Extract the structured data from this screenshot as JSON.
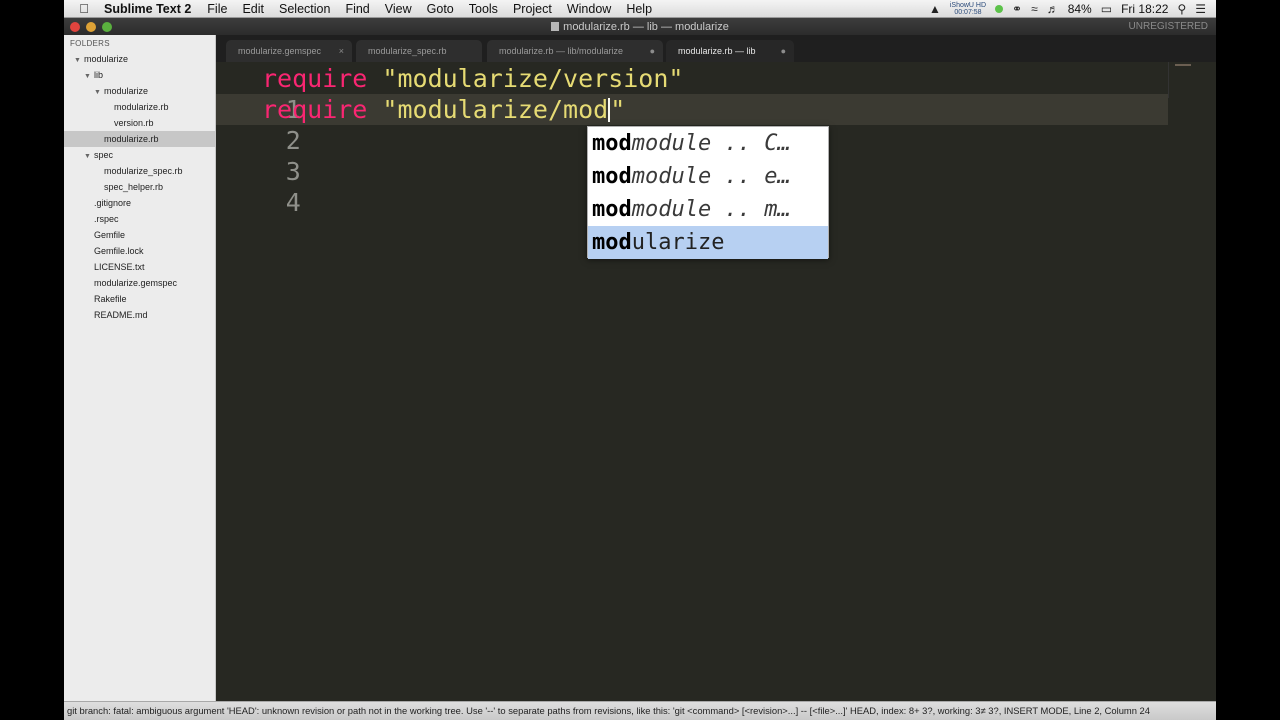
{
  "menubar": {
    "apple_icon": "apple-icon",
    "app_name": "Sublime Text 2",
    "items": [
      "File",
      "Edit",
      "Selection",
      "Find",
      "View",
      "Goto",
      "Tools",
      "Project",
      "Window",
      "Help"
    ],
    "recorder_label": "iShowU HD",
    "recorder_time": "00:07:58",
    "battery": "84%",
    "clock": "Fri 18:22",
    "icons": [
      "drive-icon",
      "headphones-icon",
      "wifi-icon",
      "volume-icon",
      "battery-icon",
      "spotlight-search-icon",
      "notifications-list-icon"
    ]
  },
  "window": {
    "title": "modularize.rb — lib — modularize",
    "unregistered": "UNREGISTERED"
  },
  "sidebar": {
    "header": "FOLDERS",
    "items": [
      {
        "label": "modularize",
        "depth": 0,
        "expanded": true,
        "selected": false
      },
      {
        "label": "lib",
        "depth": 1,
        "expanded": true,
        "selected": false
      },
      {
        "label": "modularize",
        "depth": 2,
        "expanded": true,
        "selected": false
      },
      {
        "label": "modularize.rb",
        "depth": 3,
        "expanded": null,
        "selected": false
      },
      {
        "label": "version.rb",
        "depth": 3,
        "expanded": null,
        "selected": false
      },
      {
        "label": "modularize.rb",
        "depth": 2,
        "expanded": null,
        "selected": true
      },
      {
        "label": "spec",
        "depth": 1,
        "expanded": true,
        "selected": false
      },
      {
        "label": "modularize_spec.rb",
        "depth": 2,
        "expanded": null,
        "selected": false
      },
      {
        "label": "spec_helper.rb",
        "depth": 2,
        "expanded": null,
        "selected": false
      },
      {
        "label": ".gitignore",
        "depth": 1,
        "expanded": null,
        "selected": false
      },
      {
        "label": ".rspec",
        "depth": 1,
        "expanded": null,
        "selected": false
      },
      {
        "label": "Gemfile",
        "depth": 1,
        "expanded": null,
        "selected": false
      },
      {
        "label": "Gemfile.lock",
        "depth": 1,
        "expanded": null,
        "selected": false
      },
      {
        "label": "LICENSE.txt",
        "depth": 1,
        "expanded": null,
        "selected": false
      },
      {
        "label": "modularize.gemspec",
        "depth": 1,
        "expanded": null,
        "selected": false
      },
      {
        "label": "Rakefile",
        "depth": 1,
        "expanded": null,
        "selected": false
      },
      {
        "label": "README.md",
        "depth": 1,
        "expanded": null,
        "selected": false
      }
    ]
  },
  "tabs": [
    {
      "label": "modularize.gemspec",
      "marker": "×",
      "active": false
    },
    {
      "label": "modularize_spec.rb",
      "marker": "",
      "active": false
    },
    {
      "label": "modularize.rb — lib/modularize",
      "marker": "●",
      "active": false
    },
    {
      "label": "modularize.rb — lib",
      "marker": "●",
      "active": true
    }
  ],
  "editor": {
    "current_line": 2,
    "lines": [
      {
        "number": "1",
        "keyword": "require",
        "string": "\"modularize/version\"",
        "closing": ""
      },
      {
        "number": "2",
        "keyword": "require",
        "string": "\"modularize/mod",
        "closing": "\""
      },
      {
        "number": "3",
        "keyword": "",
        "string": "",
        "closing": ""
      },
      {
        "number": "4",
        "keyword": "",
        "string": "",
        "closing": ""
      }
    ]
  },
  "autocomplete": {
    "selected_index": 3,
    "items": [
      {
        "match": "mod",
        "rest": "",
        "hint": "module .. C…"
      },
      {
        "match": "mod",
        "rest": "",
        "hint": "module .. e…"
      },
      {
        "match": "mod",
        "rest": "",
        "hint": "module .. m…"
      },
      {
        "match": "mod",
        "rest": "ularize",
        "hint": ""
      }
    ]
  },
  "statusbar": {
    "text": "git branch: fatal: ambiguous argument 'HEAD': unknown revision or path not in the working tree. Use '--' to separate paths from revisions, like this: 'git <command> [<revision>...] -- [<file>...]' HEAD, index: 8+ 3?, working: 3≠ 3?, INSERT MODE, Line 2, Column 24"
  },
  "colors": {
    "editor_bg": "#272822",
    "keyword": "#f92672",
    "string": "#e6db74",
    "line_number": "#8f908a",
    "autocomplete_selected": "#b7d0f2"
  }
}
